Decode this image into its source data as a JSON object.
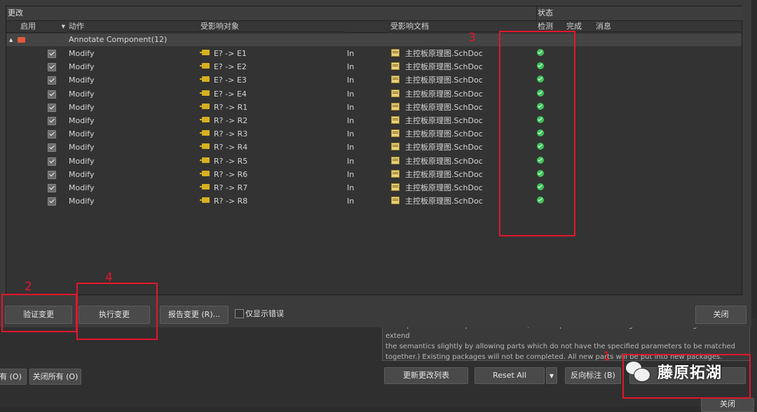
{
  "grid": {
    "group_changes": "更改",
    "group_status": "状态",
    "columns": {
      "enable": "启用",
      "action": "动作",
      "affected_object": "受影响对象",
      "affected_document": "受影响文档",
      "check": "检测",
      "done": "完成",
      "message": "消息"
    },
    "group_row": {
      "label": "Annotate Component(12)"
    },
    "rows": [
      {
        "action": "Modify",
        "object": "E? -> E1",
        "dir": "In",
        "doc": "主控板原理图.SchDoc"
      },
      {
        "action": "Modify",
        "object": "E? -> E2",
        "dir": "In",
        "doc": "主控板原理图.SchDoc"
      },
      {
        "action": "Modify",
        "object": "E? -> E3",
        "dir": "In",
        "doc": "主控板原理图.SchDoc"
      },
      {
        "action": "Modify",
        "object": "E? -> E4",
        "dir": "In",
        "doc": "主控板原理图.SchDoc"
      },
      {
        "action": "Modify",
        "object": "R? -> R1",
        "dir": "In",
        "doc": "主控板原理图.SchDoc"
      },
      {
        "action": "Modify",
        "object": "R? -> R2",
        "dir": "In",
        "doc": "主控板原理图.SchDoc"
      },
      {
        "action": "Modify",
        "object": "R? -> R3",
        "dir": "In",
        "doc": "主控板原理图.SchDoc"
      },
      {
        "action": "Modify",
        "object": "R? -> R4",
        "dir": "In",
        "doc": "主控板原理图.SchDoc"
      },
      {
        "action": "Modify",
        "object": "R? -> R5",
        "dir": "In",
        "doc": "主控板原理图.SchDoc"
      },
      {
        "action": "Modify",
        "object": "R? -> R6",
        "dir": "In",
        "doc": "主控板原理图.SchDoc"
      },
      {
        "action": "Modify",
        "object": "R? -> R7",
        "dir": "In",
        "doc": "主控板原理图.SchDoc"
      },
      {
        "action": "Modify",
        "object": "R? -> R8",
        "dir": "In",
        "doc": "主控板原理图.SchDoc"
      }
    ]
  },
  "buttons": {
    "validate": "验证变更",
    "execute": "执行变更",
    "report": "报告变更 (R)...",
    "errors_only": "仅显示错误",
    "close": "关闭",
    "open_all": "有 (O)",
    "close_all": "关闭所有 (O)",
    "update_list": "更新更改列表",
    "reset_all": "Reset All",
    "back_annotate": "反向标注 (B)",
    "bottom_close": "关闭"
  },
  "description": [
    "same parameters and parameter values, with respect to the matching criteria. Disabling this will extend",
    "the semantics slightly by allowing parts which do not have the specified parameters to be matched",
    "together.) Existing packages will not be completed. All new parts will be put into new packages."
  ],
  "annotations": {
    "n1": "1",
    "n2": "2",
    "n3": "3",
    "n4": "4"
  },
  "watermark": "藤原拓湖",
  "colors": {
    "annotation_red": "#e3162b",
    "ok_green": "#3fc35a"
  }
}
